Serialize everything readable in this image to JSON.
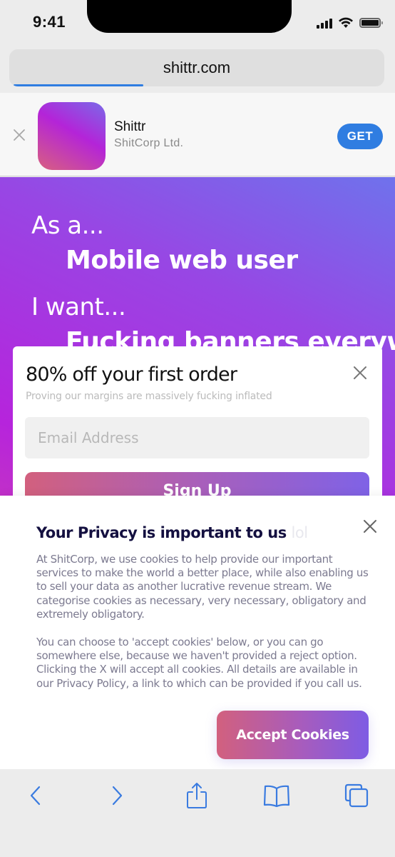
{
  "status_bar": {
    "time": "9:41",
    "signal_icon": "cellular-signal-icon",
    "wifi_icon": "wifi-icon",
    "battery_icon": "battery-icon"
  },
  "browser": {
    "url": "shittr.com",
    "load_progress_percent": 35,
    "accent_color": "#2f7de1"
  },
  "app_banner": {
    "close_icon": "close-icon",
    "app_name": "Shittr",
    "company": "ShitCorp Ltd.",
    "get_label": "GET"
  },
  "hero": {
    "line1_label": "As a...",
    "line1_value": "Mobile web user",
    "line2_label": "I want...",
    "line2_value": "Fucking banners everywhere"
  },
  "newsletter": {
    "title": "80% off your first order",
    "subtitle": "Proving our margins are massively fucking inflated",
    "email_placeholder": "Email Address",
    "email_value": "",
    "signup_label": "Sign Up",
    "close_icon": "close-icon"
  },
  "cookie_banner": {
    "title": "Your Privacy is important to us",
    "title_suffix": "lol",
    "paragraph1": "At ShitCorp, we use cookies to help provide our important services to make the world a better place, while also enabling us to sell your data as another lucrative revenue stream. We categorise cookies as necessary, very necessary, obligatory and extremely obligatory.",
    "paragraph2": "You can choose to 'accept cookies' below, or you can go somewhere else, because we haven't provided a reject option. Clicking the X will accept all cookies. All details are available in our Privacy Policy, a link to which can be provided if you call us.",
    "accept_label": "Accept Cookies",
    "close_icon": "close-icon"
  },
  "toolbar": {
    "items": [
      {
        "name": "back",
        "icon": "chevron-left-icon"
      },
      {
        "name": "forward",
        "icon": "chevron-right-icon"
      },
      {
        "name": "share",
        "icon": "share-icon"
      },
      {
        "name": "bookmarks",
        "icon": "book-icon"
      },
      {
        "name": "tabs",
        "icon": "tabs-icon"
      }
    ]
  }
}
